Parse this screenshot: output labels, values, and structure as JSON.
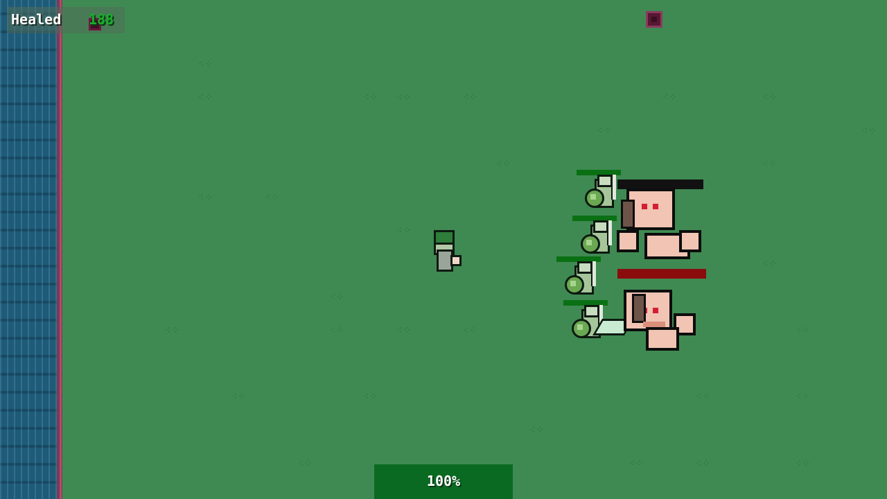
{
  "hud": {
    "healed_label": "Healed",
    "healed_value": "188"
  },
  "progress": {
    "value": 1.0,
    "label": "100%",
    "fill_color": "#0b6a22"
  },
  "colors": {
    "grass": "#3f8a52",
    "water": "#1e5b78",
    "shore": "#7a3b55",
    "healthbar": "#0a7014",
    "enemy_health": "#8a0c0c",
    "enemy_flesh": "#f1c4b3"
  },
  "units": {
    "healer": {
      "type": "wizard"
    },
    "soldiers": [
      {
        "health": 1.0
      },
      {
        "health": 1.0
      },
      {
        "health": 1.0
      },
      {
        "health": 1.0
      }
    ],
    "enemies": [
      {
        "type": "ogre",
        "health": 0.0
      },
      {
        "type": "ogre",
        "health": 1.0
      }
    ]
  },
  "icons": {
    "map_marker": "square-marker-icon",
    "hud_marker": "square-marker-icon"
  }
}
